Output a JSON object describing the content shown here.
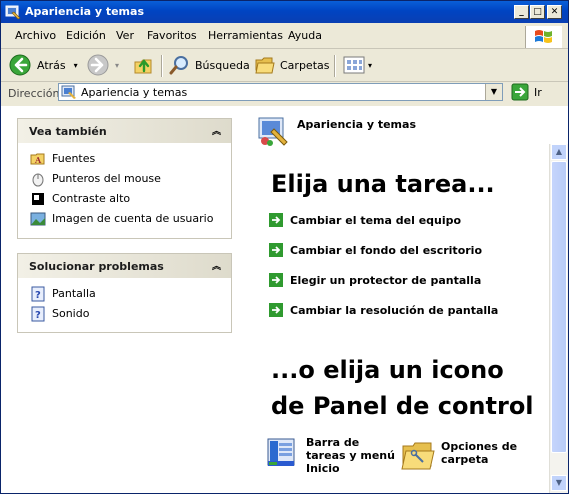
{
  "window": {
    "title": "Apariencia y temas"
  },
  "menu": {
    "items": [
      "Archivo",
      "Edición",
      "Ver",
      "Favoritos",
      "Herramientas",
      "Ayuda"
    ]
  },
  "toolbar": {
    "back_label": "Atrás",
    "search_label": "Búsqueda",
    "folders_label": "Carpetas"
  },
  "address": {
    "label": "Dirección",
    "value": "Apariencia y temas",
    "go_label": "Ir"
  },
  "see_also": {
    "title": "Vea también",
    "items": [
      "Fuentes",
      "Punteros del mouse",
      "Contraste alto",
      "Imagen de cuenta de usuario"
    ]
  },
  "troubleshoot": {
    "title": "Solucionar problemas",
    "items": [
      "Pantalla",
      "Sonido"
    ]
  },
  "main": {
    "section_title": "Apariencia y temas",
    "pick_task": "Elija una tarea...",
    "tasks": [
      "Cambiar el tema del equipo",
      "Cambiar el fondo del escritorio",
      "Elegir un protector de pantalla",
      "Cambiar la resolución de pantalla"
    ],
    "or_pick_line1": "...o elija un icono",
    "or_pick_line2": "de Panel de control",
    "icons": [
      {
        "label_line1": "Barra de",
        "label_line2": "tareas y menú",
        "label_line3": "Inicio"
      },
      {
        "label_line1": "Opciones de",
        "label_line2": "carpeta"
      }
    ]
  },
  "colors": {
    "titlebar": "#0a5fd8",
    "panel_head": "#dedbcc",
    "task_arrow": "#2f9a2f"
  }
}
